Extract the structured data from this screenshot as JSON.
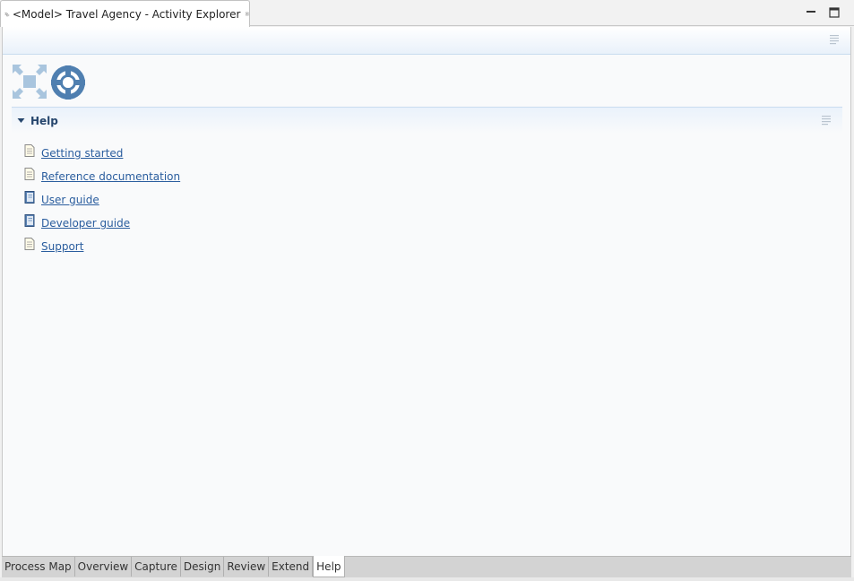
{
  "editor_tab": {
    "title": "<Model> Travel Agency - Activity Explorer"
  },
  "window_controls": {
    "minimize_icon": "minimize-icon",
    "maximize_icon": "maximize-icon"
  },
  "section": {
    "title": "Help",
    "items": [
      {
        "label": "Getting started",
        "icon": "document-icon"
      },
      {
        "label": "Reference documentation",
        "icon": "document-icon"
      },
      {
        "label": "User guide",
        "icon": "book-icon"
      },
      {
        "label": "Developer guide",
        "icon": "book-icon"
      },
      {
        "label": "Support",
        "icon": "document-icon"
      }
    ]
  },
  "page_tabs": [
    {
      "label": "Process Map",
      "active": false
    },
    {
      "label": "Overview",
      "active": false
    },
    {
      "label": "Capture",
      "active": false
    },
    {
      "label": "Design",
      "active": false
    },
    {
      "label": "Review",
      "active": false
    },
    {
      "label": "Extend",
      "active": false
    },
    {
      "label": "Help",
      "active": true
    }
  ],
  "colors": {
    "link": "#2a5d9e",
    "section_title": "#26466d",
    "logo_blue": "#4f7fb0",
    "logo_light": "#a9c5de"
  }
}
